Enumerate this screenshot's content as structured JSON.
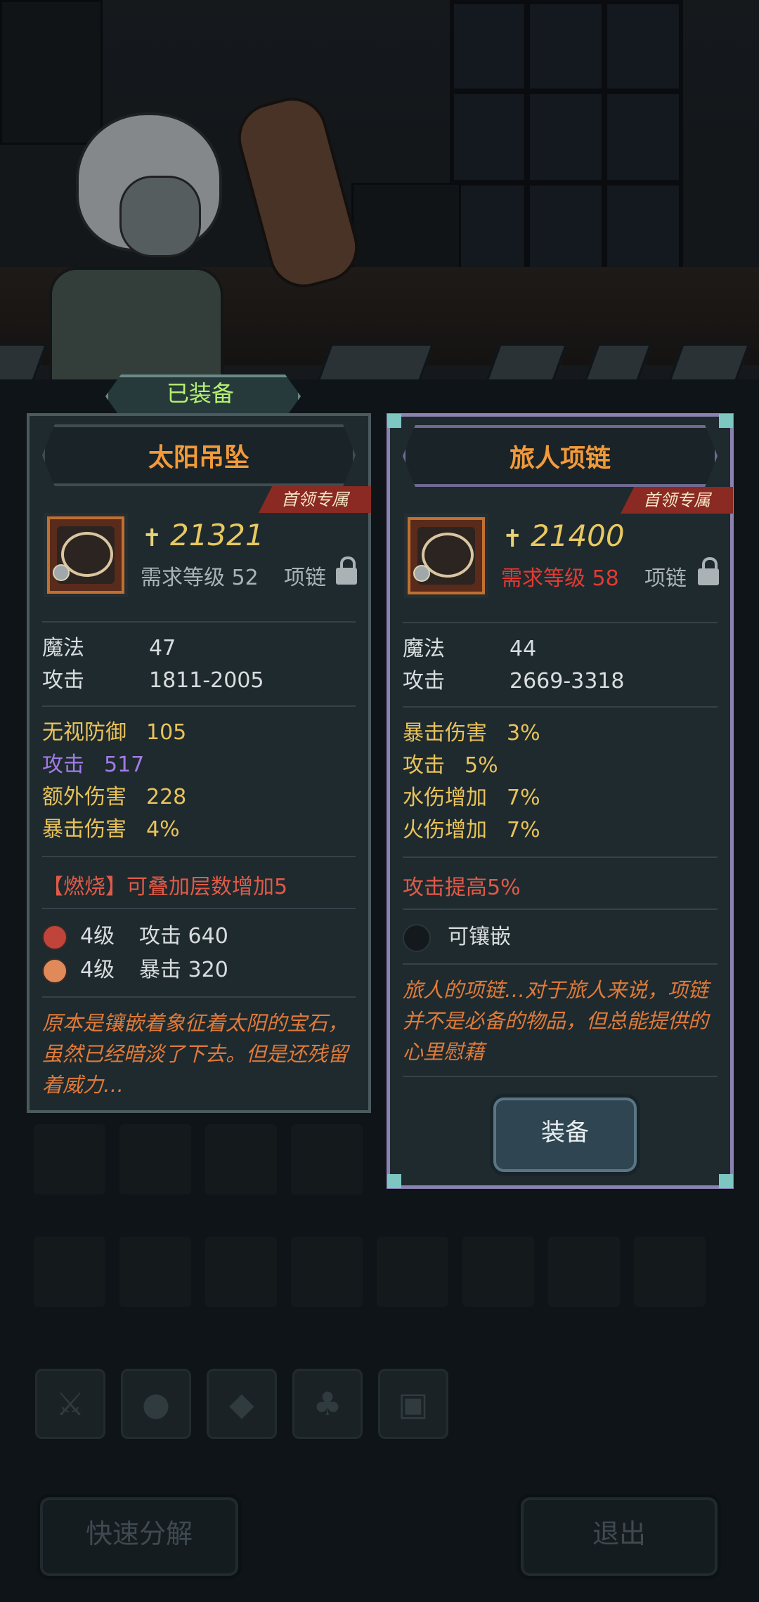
{
  "tab": {
    "equipped_label": "已装备"
  },
  "left_item": {
    "name": "太阳吊坠",
    "ribbon": "首领专属",
    "power": "21321",
    "req_level": "需求等级 52",
    "slot": "项链",
    "base_stats": [
      {
        "key": "魔法",
        "value": "47"
      },
      {
        "key": "攻击",
        "value": "1811-2005"
      }
    ],
    "bonus_stats": [
      {
        "key": "无视防御",
        "value": "105",
        "color": "yellow"
      },
      {
        "key": "攻击",
        "value": "517",
        "color": "purple"
      },
      {
        "key": "额外伤害",
        "value": "228",
        "color": "yellow"
      },
      {
        "key": "暴击伤害",
        "value": "4%",
        "color": "yellow"
      }
    ],
    "special": "【燃烧】可叠加层数增加5",
    "gems": [
      {
        "level": "4级",
        "stat": "攻击 640"
      },
      {
        "level": "4级",
        "stat": "暴击 320"
      }
    ],
    "description": "原本是镶嵌着象征着太阳的宝石，虽然已经暗淡了下去。但是还残留着威力…"
  },
  "right_item": {
    "name": "旅人项链",
    "ribbon": "首领专属",
    "power": "21400",
    "req_level": "需求等级 58",
    "slot": "项链",
    "base_stats": [
      {
        "key": "魔法",
        "value": "44"
      },
      {
        "key": "攻击",
        "value": "2669-3318"
      }
    ],
    "bonus_stats": [
      {
        "key": "暴击伤害",
        "value": "3%"
      },
      {
        "key": "攻击",
        "value": "5%"
      },
      {
        "key": "水伤增加",
        "value": "7%"
      },
      {
        "key": "火伤增加",
        "value": "7%"
      }
    ],
    "special": "攻击提高5%",
    "socket_label": "可镶嵌",
    "description": "旅人的项链…对于旅人来说，项链并不是必备的物品，但总能提供的心里慰藉",
    "equip_button": "装备"
  },
  "bottom": {
    "quick_decompose": "快速分解",
    "exit": "退出"
  },
  "colors": {
    "title_orange": "#f29a3a",
    "power_gold": "#e8c860",
    "requirement_red": "#e23a34",
    "bonus_yellow": "#e9c25a",
    "bonus_purple": "#a27be6",
    "special_red": "#e05a48",
    "desc_orange": "#e07a3a"
  },
  "icons": {
    "power": "strength-arm-icon",
    "lock": "lock-icon",
    "gem1": "red-gem-icon",
    "gem2": "orange-gem-icon",
    "filters": [
      "weapon-filter-icon",
      "paw-filter-icon",
      "gem-filter-icon",
      "leaf-filter-icon",
      "chest-filter-icon"
    ]
  }
}
